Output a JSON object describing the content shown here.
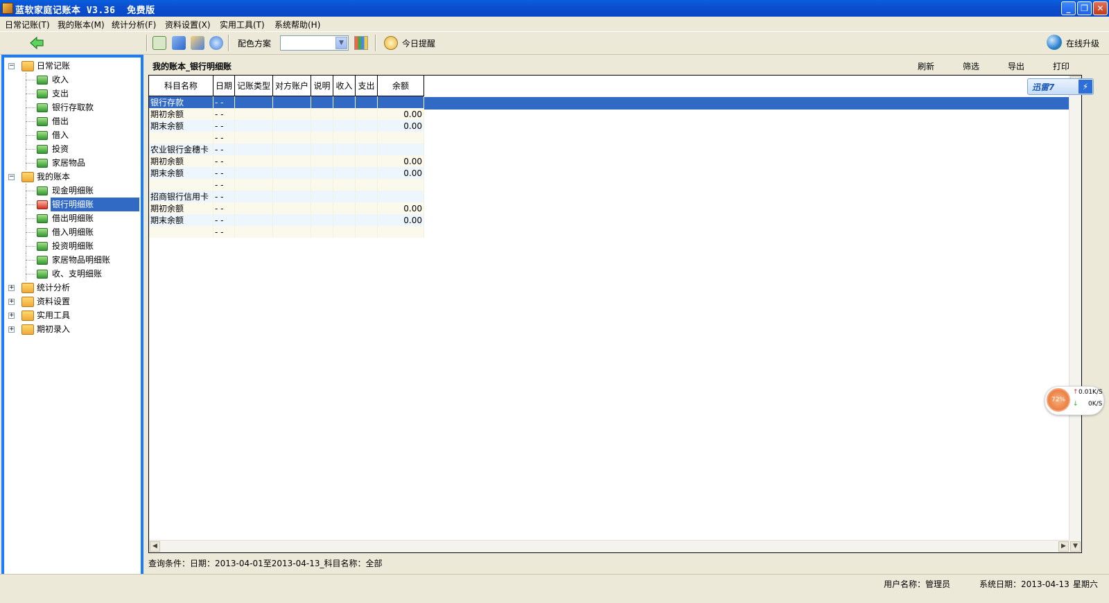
{
  "window": {
    "title": "蓝软家庭记账本 V3.36  免费版",
    "min_glyph": "_",
    "max_glyph": "❐",
    "close_glyph": "✕"
  },
  "menu": [
    {
      "label": "日常记账(T)"
    },
    {
      "label": "我的账本(M)"
    },
    {
      "label": "统计分析(F)"
    },
    {
      "label": "资料设置(X)"
    },
    {
      "label": "实用工具(T)"
    },
    {
      "label": "系统帮助(H)"
    }
  ],
  "toolbar": {
    "back_icon": "green-left-arrow",
    "color_scheme_label": "配色方案",
    "color_scheme_value": "",
    "today_reminder_label": "今日提醒",
    "online_upgrade_label": "在线升级"
  },
  "tree": {
    "nodes": [
      {
        "label": "日常记账",
        "type": "group",
        "expanded": true
      },
      {
        "label": "收入",
        "type": "item"
      },
      {
        "label": "支出",
        "type": "item"
      },
      {
        "label": "银行存取款",
        "type": "item"
      },
      {
        "label": "借出",
        "type": "item"
      },
      {
        "label": "借入",
        "type": "item"
      },
      {
        "label": "投资",
        "type": "item"
      },
      {
        "label": "家居物品",
        "type": "item"
      },
      {
        "label": "我的账本",
        "type": "group",
        "expanded": true
      },
      {
        "label": "现金明细账",
        "type": "item"
      },
      {
        "label": "银行明细账",
        "type": "item",
        "selected": true
      },
      {
        "label": "借出明细账",
        "type": "item"
      },
      {
        "label": "借入明细账",
        "type": "item"
      },
      {
        "label": "投资明细账",
        "type": "item"
      },
      {
        "label": "家居物品明细账",
        "type": "item"
      },
      {
        "label": "收、支明细账",
        "type": "item"
      },
      {
        "label": "统计分析",
        "type": "group",
        "expanded": false
      },
      {
        "label": "资料设置",
        "type": "group",
        "expanded": false
      },
      {
        "label": "实用工具",
        "type": "group",
        "expanded": false
      },
      {
        "label": "期初录入",
        "type": "group",
        "expanded": false
      }
    ]
  },
  "main": {
    "title": "我的账本_银行明细账",
    "actions": {
      "refresh": "刷新",
      "filter": "筛选",
      "export": "导出",
      "print": "打印"
    },
    "columns": [
      "科目名称",
      "日期",
      "记账类型",
      "对方账户",
      "说明",
      "收入",
      "支出",
      "余额"
    ],
    "rows": [
      [
        "银行存款",
        "- -",
        "",
        "",
        "",
        "",
        "",
        ""
      ],
      [
        "期初余额",
        "- -",
        "",
        "",
        "",
        "",
        "",
        "0.00"
      ],
      [
        "期末余额",
        "- -",
        "",
        "",
        "",
        "",
        "",
        "0.00"
      ],
      [
        "",
        "- -",
        "",
        "",
        "",
        "",
        "",
        ""
      ],
      [
        "农业银行金穗卡",
        "- -",
        "",
        "",
        "",
        "",
        "",
        ""
      ],
      [
        "期初余额",
        "- -",
        "",
        "",
        "",
        "",
        "",
        "0.00"
      ],
      [
        "期末余额",
        "- -",
        "",
        "",
        "",
        "",
        "",
        "0.00"
      ],
      [
        "",
        "- -",
        "",
        "",
        "",
        "",
        "",
        ""
      ],
      [
        "招商银行信用卡",
        "- -",
        "",
        "",
        "",
        "",
        "",
        ""
      ],
      [
        "期初余额",
        "- -",
        "",
        "",
        "",
        "",
        "",
        "0.00"
      ],
      [
        "期末余额",
        "- -",
        "",
        "",
        "",
        "",
        "",
        "0.00"
      ],
      [
        "",
        "- -",
        "",
        "",
        "",
        "",
        "",
        ""
      ]
    ],
    "selected_row": 0,
    "query": "查询条件：日期：2013-04-01至2013-04-13_科目名称：全部"
  },
  "status": {
    "user": "用户名称：管理员",
    "date": "系统日期：2013-04-13",
    "weekday": "星期六"
  },
  "overlays": {
    "xunlei_label": "迅雷7",
    "net_percent": "72%",
    "net_up": "0.01K/S",
    "net_down": "0K/S"
  },
  "colors": {
    "titlebar": "#0a5fdc",
    "panel_border": "#1a7cff",
    "selection": "#316ac5",
    "window_bg": "#ece9d8"
  }
}
